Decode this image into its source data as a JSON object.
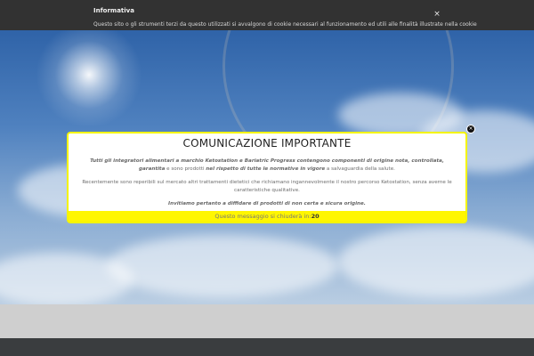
{
  "cookie_banner": {
    "title": "Informativa",
    "text": "Questo sito o gli strumenti terzi da questo utilizzati si avvalgono di cookie necessari al funzionamento ed utili alle finalità illustrate nella cookie",
    "close_glyph": "×"
  },
  "modal": {
    "title": "COMUNICAZIONE IMPORTANTE",
    "close_glyph": "×",
    "p1": {
      "strong": "Tutti gli integratori alimentari a marchio Ketostation e Bariatric Progress contengono componenti di origine nota, controllata, garantita",
      "text1": " e sono prodotti ",
      "strong2": "nel rispetto di tutte le normative in vigore",
      "text2": " a salvaguardia della salute."
    },
    "p2": "Recentemente sono reperibili sul mercato altri trattamenti dietetici che richiamano ingannevolmente il nostro percorso Ketostation, senza averne le caratteristiche qualitative.",
    "p3": "Invitiamo pertanto a diffidare di prodotti di non certa e sicura origine.",
    "footer_text": "Questo messaggio si chiuderà in:",
    "countdown": "20"
  },
  "colors": {
    "modal_border": "#f4f400",
    "modal_footer": "#fff600",
    "cookie_bar": "#323232",
    "footer": "#3a3d3f"
  }
}
